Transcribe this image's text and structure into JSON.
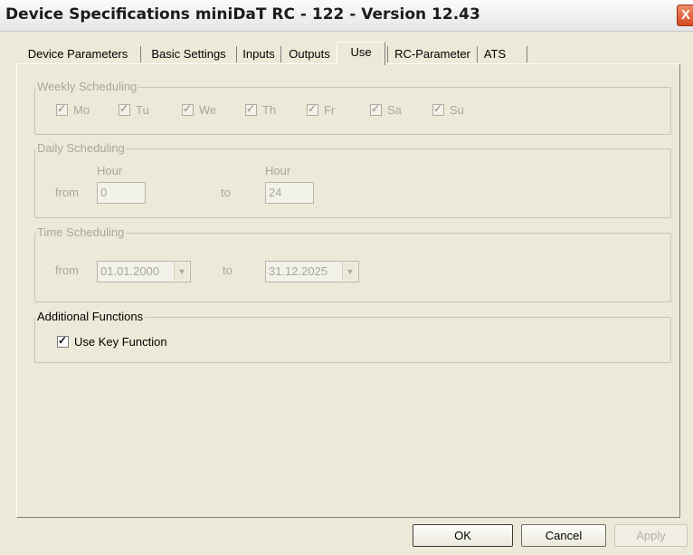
{
  "window": {
    "title": "Device Specifications miniDaT RC - 122 - Version 12.43",
    "close_glyph": "X"
  },
  "tabs": [
    {
      "label": "Device Parameters"
    },
    {
      "label": "Basic Settings"
    },
    {
      "label": "Inputs"
    },
    {
      "label": "Outputs"
    },
    {
      "label": "Use",
      "active": true
    },
    {
      "label": "RC-Parameter"
    },
    {
      "label": "ATS"
    }
  ],
  "weekly": {
    "title": "Weekly Scheduling",
    "days": [
      {
        "label": "Mo",
        "checked": true
      },
      {
        "label": "Tu",
        "checked": true
      },
      {
        "label": "We",
        "checked": true
      },
      {
        "label": "Th",
        "checked": true
      },
      {
        "label": "Fr",
        "checked": true
      },
      {
        "label": "Sa",
        "checked": true
      },
      {
        "label": "Su",
        "checked": true
      }
    ]
  },
  "daily": {
    "title": "Daily Scheduling",
    "hour_label": "Hour",
    "from_label": "from",
    "to_label": "to",
    "from_value": "0",
    "to_value": "24"
  },
  "time": {
    "title": "Time Scheduling",
    "from_label": "from",
    "to_label": "to",
    "from_value": "01.01.2000",
    "to_value": "31.12.2025"
  },
  "additional": {
    "title": "Additional Functions",
    "use_key_label": "Use Key Function",
    "use_key_checked": true
  },
  "buttons": {
    "ok": "OK",
    "cancel": "Cancel",
    "apply": "Apply"
  },
  "glyphs": {
    "check": "✓",
    "dropdown": "▼"
  }
}
